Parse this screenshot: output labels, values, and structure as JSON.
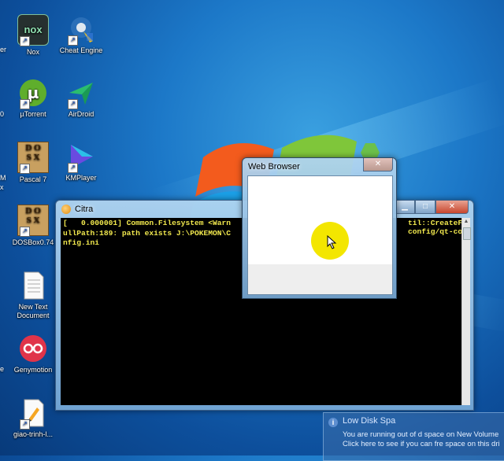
{
  "desktop_icons": [
    {
      "label": "Nox",
      "icon": "nox-icon"
    },
    {
      "label": "Cheat Engine",
      "icon": "cheat-engine-icon"
    },
    {
      "label": "µTorrent",
      "icon": "utorrent-icon"
    },
    {
      "label": "AirDroid",
      "icon": "airdroid-icon"
    },
    {
      "label": "Pascal 7",
      "icon": "dosbox-icon"
    },
    {
      "label": "KMPlayer",
      "icon": "kmplayer-icon"
    },
    {
      "label": "DOSBox0.74",
      "icon": "dosbox-icon"
    },
    {
      "label": "New Text Document",
      "icon": "text-document-icon"
    },
    {
      "label": "Genymotion",
      "icon": "genymotion-icon"
    },
    {
      "label": "giao-trinh-l...",
      "icon": "pdf-document-icon"
    }
  ],
  "partial_labels": [
    "er",
    "0",
    "M",
    "x",
    "e"
  ],
  "citra_window": {
    "title": "Citra",
    "console_lines": [
      "[   0.000001] Common.Filesystem <Warn",
      "ullPath:189: path exists J:\\POKEMON\\C",
      "nfig.ini"
    ],
    "console_tail_lines": [
      "til::CreateF",
      "config/qt-co"
    ]
  },
  "web_browser_window": {
    "title": "Web Browser"
  },
  "notification": {
    "title": "Low Disk Spa",
    "line1": "You are running out of d     space on New Volume",
    "line2": "Click here to see if you can fre    space on this dri"
  },
  "colors": {
    "console_text": "#f2e94e",
    "cursor_highlight": "#f3e600",
    "desktop_blue": "#1c78c8"
  }
}
